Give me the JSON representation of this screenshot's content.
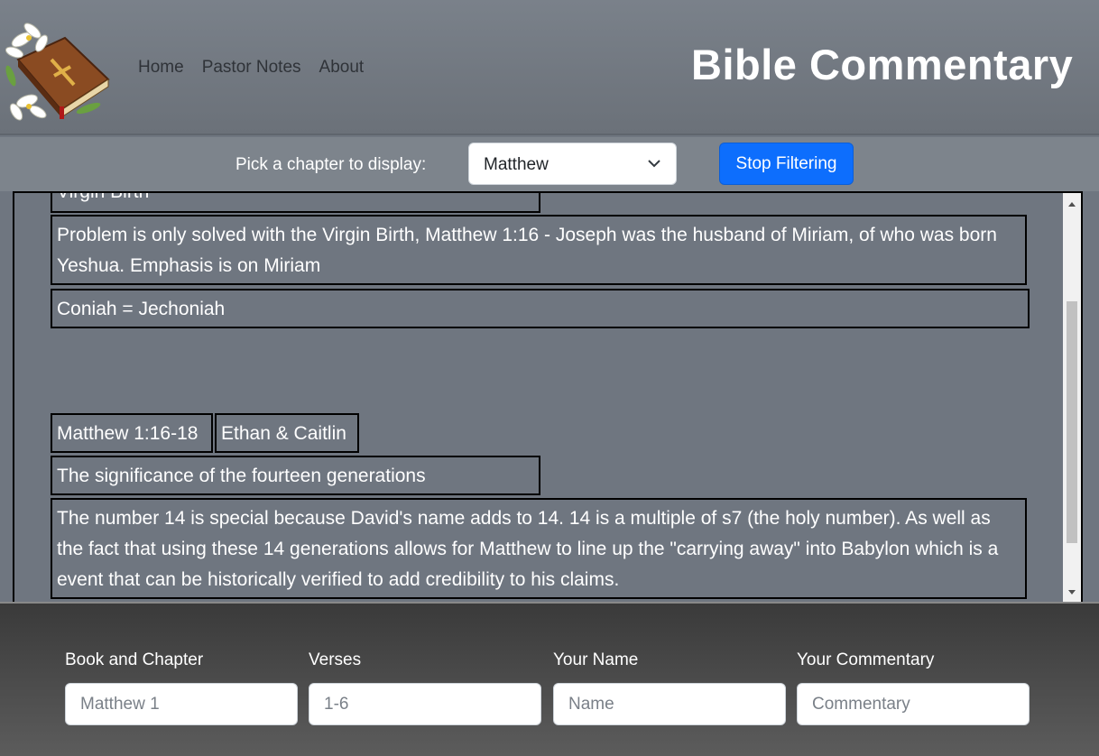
{
  "header": {
    "title": "Bible Commentary",
    "nav": [
      "Home",
      "Pastor Notes",
      "About"
    ]
  },
  "filter": {
    "label": "Pick a chapter to display:",
    "selected": "Matthew",
    "button": "Stop Filtering"
  },
  "entries": {
    "partial_heading": "Virgin Birth",
    "note1": "Problem is only solved with the Virgin Birth, Matthew 1:16 - Joseph was the husband of Miriam, of who was born Yeshua. Emphasis is on Miriam",
    "note2": "Coniah = Jechoniah",
    "ref": "Matthew 1:16-18",
    "author": "Ethan & Caitlin",
    "heading": "The significance of the fourteen generations",
    "body": "The number 14 is special because David's name adds to 14. 14 is a multiple of s7 (the holy number). As well as the fact that using these 14 generations allows for Matthew to line up the \"carrying away\" into Babylon which is a event that can be historically verified to add credibility to his claims."
  },
  "form": {
    "fields": [
      {
        "label": "Book and Chapter",
        "placeholder": "Matthew 1"
      },
      {
        "label": "Verses",
        "placeholder": "1-6"
      },
      {
        "label": "Your Name",
        "placeholder": "Name"
      },
      {
        "label": "Your Commentary",
        "placeholder": "Commentary"
      }
    ]
  },
  "colors": {
    "accent": "#0d6efd",
    "page_bg": "#6f7680",
    "footer_bg": "#4a4a4a"
  }
}
